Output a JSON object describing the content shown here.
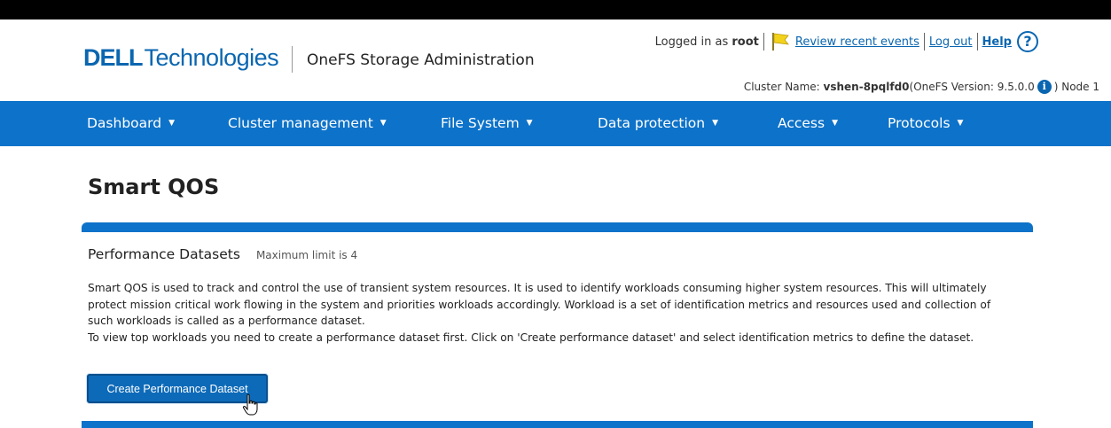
{
  "brand": {
    "logo_dell": "DELL",
    "logo_technologies": "Technologies",
    "app_title": "OneFS Storage Administration"
  },
  "user": {
    "logged_in_prefix": "Logged in as",
    "username": "root",
    "review_events": "Review recent events",
    "logout": "Log out",
    "help": "Help",
    "help_icon_glyph": "?"
  },
  "cluster": {
    "name_label": "Cluster Name:",
    "name": "vshen-8pqlfd0",
    "version_label": "(OneFS Version: 9.5.0.0",
    "info_icon_glyph": "i",
    "suffix": ") Node 1"
  },
  "nav": {
    "items": [
      {
        "label": "Dashboard"
      },
      {
        "label": "Cluster management"
      },
      {
        "label": "File System"
      },
      {
        "label": "Data protection"
      },
      {
        "label": "Access"
      },
      {
        "label": "Protocols"
      }
    ],
    "caret": "▼"
  },
  "page": {
    "title": "Smart QOS"
  },
  "section": {
    "title": "Performance Datasets",
    "limit": "Maximum limit is 4",
    "description_1": "Smart QOS is used to track and control the use of transient system resources. It is used to identify workloads consuming higher system resources. This will ultimately protect mission critical work flowing in the system and priorities workloads accordingly. Workload is a set of identification metrics and resources used and collection of such workloads is called as a performance dataset.",
    "description_2": "To view top workloads you need to create a performance dataset first. Click on 'Create performance dataset' and select identification metrics to define the dataset.",
    "create_button": "Create Performance Dataset"
  },
  "colors": {
    "nav_bg": "#0d72c9",
    "brand_blue": "#0a66b0",
    "button_bg": "#0d6ab8",
    "flag_yellow": "#f3d21b"
  },
  "icons": {
    "flag": "flag-icon",
    "help": "help-icon",
    "info": "info-icon",
    "cursor": "hand-pointer-icon"
  }
}
